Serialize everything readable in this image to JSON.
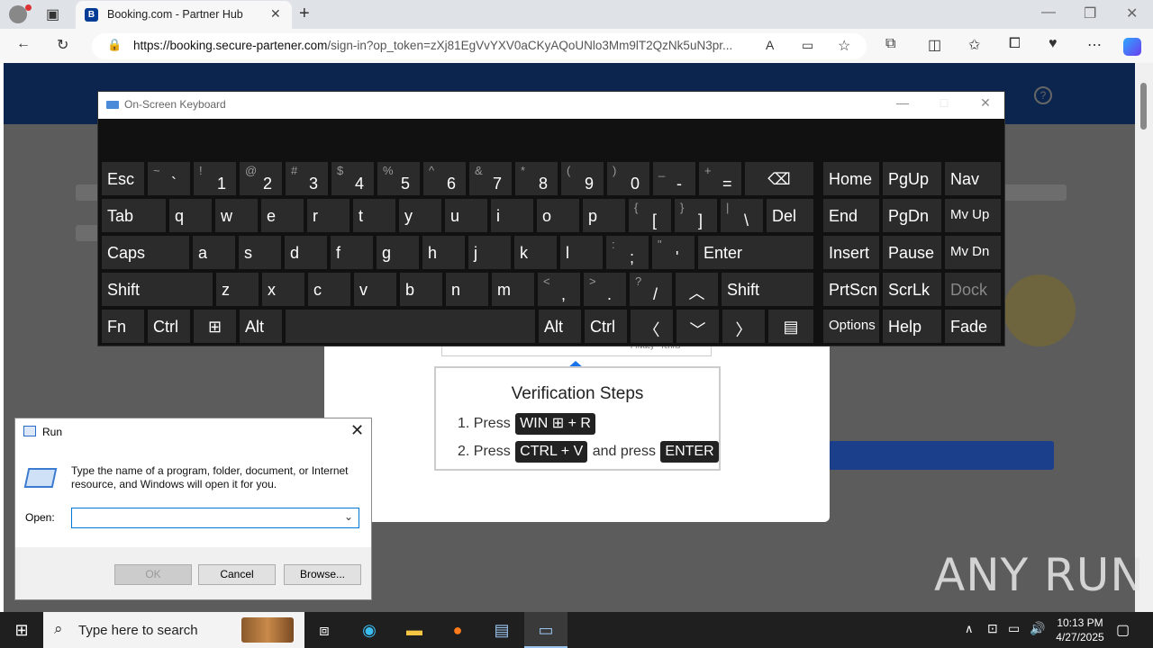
{
  "browser": {
    "tab_title": "Booking.com - Partner Hub",
    "tab_favicon_letter": "B",
    "url_domain": "https://booking.secure-partener.com",
    "url_rest": "/sign-in?op_token=zXj81EgVvYXV0aCKyAQoUNlo3Mm9lT2QzNk5uN3pr..."
  },
  "page": {
    "captcha_footer": "Privacy - Terms",
    "verify_title": "Verification Steps",
    "step1_prefix": "1. Press",
    "step1_key": "WIN",
    "step1_suffix": "+ R",
    "step2_prefix": "2. Press",
    "step2_key": "CTRL + V",
    "step2_mid": "and press",
    "step2_key2": "ENTER"
  },
  "osk": {
    "title": "On-Screen Keyboard",
    "keys": [
      {
        "s": "~",
        "m": "`"
      },
      {
        "s": "!",
        "m": "1"
      },
      {
        "s": "@",
        "m": "2"
      },
      {
        "s": "#",
        "m": "3"
      },
      {
        "s": "$",
        "m": "4"
      },
      {
        "s": "%",
        "m": "5"
      },
      {
        "s": "^",
        "m": "6"
      },
      {
        "s": "&",
        "m": "7"
      },
      {
        "s": "*",
        "m": "8"
      },
      {
        "s": "(",
        "m": "9"
      },
      {
        "s": ")",
        "m": "0"
      },
      {
        "s": "_",
        "m": "-"
      },
      {
        "s": "+",
        "m": "="
      },
      {
        "s": "{",
        "m": "["
      },
      {
        "s": "}",
        "m": "]"
      },
      {
        "s": "|",
        "m": "\\"
      },
      {
        "s": ":",
        "m": ";"
      },
      {
        "s": "\"",
        "m": "'"
      },
      {
        "s": "<",
        "m": ","
      },
      {
        "s": ">",
        "m": "."
      },
      {
        "s": "?",
        "m": "/"
      }
    ],
    "labels": {
      "esc": "Esc",
      "tab": "Tab",
      "caps": "Caps",
      "shift": "Shift",
      "fn": "Fn",
      "ctrl": "Ctrl",
      "alt": "Alt",
      "del": "Del",
      "enter": "Enter",
      "home": "Home",
      "pgup": "PgUp",
      "nav": "Nav",
      "end": "End",
      "pgdn": "PgDn",
      "mvup": "Mv Up",
      "insert": "Insert",
      "pause": "Pause",
      "mvdn": "Mv Dn",
      "prtscn": "PrtScn",
      "scrlk": "ScrLk",
      "dock": "Dock",
      "options": "Options",
      "help": "Help",
      "fade": "Fade"
    },
    "row_q": [
      "q",
      "w",
      "e",
      "r",
      "t",
      "y",
      "u",
      "i",
      "o",
      "p"
    ],
    "row_a": [
      "a",
      "s",
      "d",
      "f",
      "g",
      "h",
      "j",
      "k",
      "l"
    ],
    "row_z": [
      "z",
      "x",
      "c",
      "v",
      "b",
      "n",
      "m"
    ]
  },
  "run": {
    "title": "Run",
    "description": "Type the name of a program, folder, document, or Internet resource, and Windows will open it for you.",
    "open_label": "Open:",
    "open_value": "",
    "ok": "OK",
    "cancel": "Cancel",
    "browse": "Browse..."
  },
  "taskbar": {
    "search_placeholder": "Type here to search",
    "time": "10:13 PM",
    "date": "4/27/2025"
  },
  "watermark": "ANY RUN"
}
